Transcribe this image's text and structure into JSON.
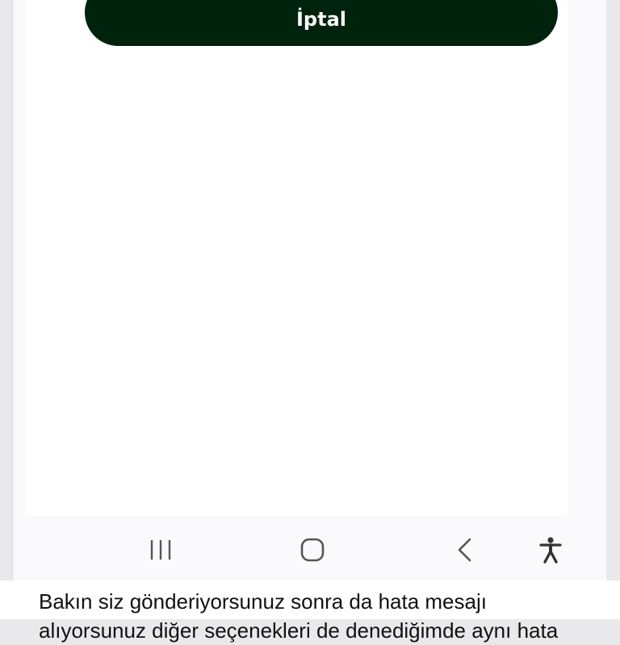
{
  "dialog": {
    "cancel_label": "İptal"
  },
  "navigation_bar": {
    "recents_icon": "recent-apps-icon",
    "home_icon": "home-icon",
    "back_icon": "back-chevron-icon",
    "accessibility_icon": "accessibility-person-icon"
  },
  "caption": {
    "line1": "Bakın siz gönderiyorsunuz sonra da hata mesajı",
    "line2": "alıyorsunuz diğer seçenekleri de denediğimde aynı hata"
  },
  "colors": {
    "button_background": "#00230d",
    "button_text": "#ffffff",
    "screen_background": "#ffffff",
    "nav_icon": "#555555"
  }
}
